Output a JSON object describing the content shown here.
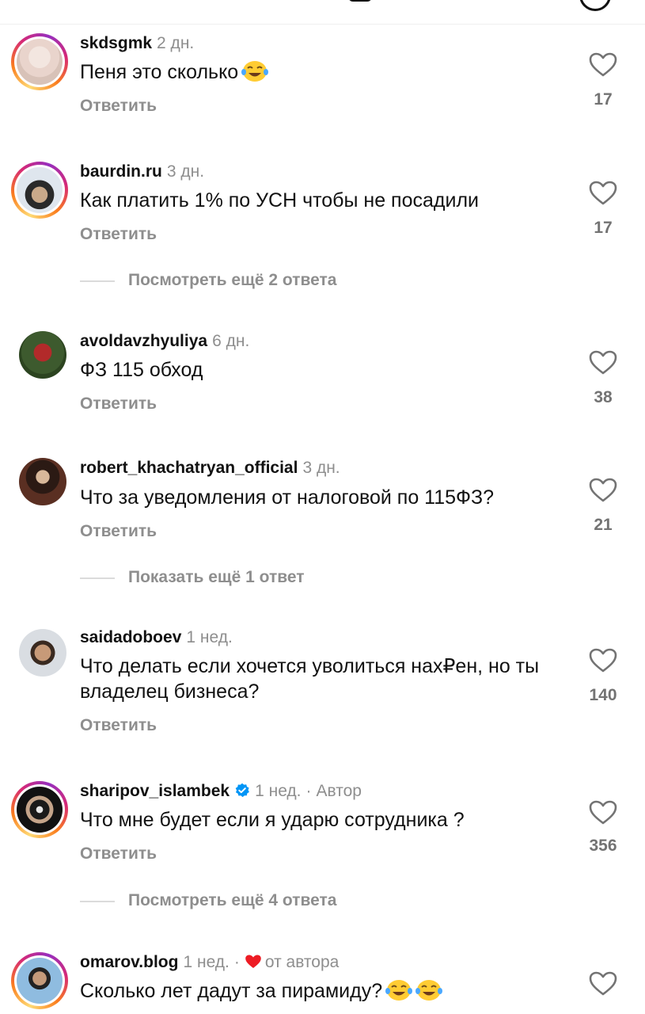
{
  "header": {},
  "comments": [
    {
      "username": "skdsgmk",
      "time": "2 дн.",
      "text": "Пеня это сколько",
      "emoji": "😂",
      "reply_label": "Ответить",
      "likes": "17",
      "has_story_ring": true
    },
    {
      "username": "baurdin.ru",
      "time": "3 дн.",
      "text": "Как платить 1% по УСН чтобы не посадили",
      "reply_label": "Ответить",
      "likes": "17",
      "has_story_ring": true,
      "more_replies": "Посмотреть ещё 2 ответа"
    },
    {
      "username": "avoldavzhyuliya",
      "time": "6 дн.",
      "text": "ФЗ 115 обход",
      "reply_label": "Ответить",
      "likes": "38",
      "has_story_ring": false
    },
    {
      "username": "robert_khachatryan_official",
      "time": "3 дн.",
      "text": "Что за уведомления от налоговой по 115ФЗ?",
      "reply_label": "Ответить",
      "likes": "21",
      "has_story_ring": false,
      "more_replies": "Показать ещё 1 ответ"
    },
    {
      "username": "saidadoboev",
      "time": "1 нед.",
      "text": "Что делать если хочется уволиться нах₽ен, но ты владелец бизнеса?",
      "reply_label": "Ответить",
      "likes": "140",
      "has_story_ring": false
    },
    {
      "username": "sharipov_islambek",
      "time": "1 нед.",
      "author_label": "Автор",
      "verified": true,
      "text": "Что мне будет если я ударю сотрудника ?",
      "reply_label": "Ответить",
      "likes": "356",
      "has_story_ring": true,
      "more_replies": "Посмотреть ещё 4 ответа"
    },
    {
      "username": "omarov.blog",
      "time": "1 нед.",
      "liked_by_author_label": "от автора",
      "text": "Сколько лет дадут за пирамиду?",
      "emoji": "😂😂",
      "likes": "",
      "has_story_ring": true
    }
  ],
  "colors": {
    "text_primary": "#111111",
    "text_secondary": "#8e8e8e",
    "verified_blue": "#0095f6",
    "heart_red": "#ed1c24"
  },
  "icons": {
    "like": "heart-outline-icon",
    "verified": "verified-badge-icon",
    "author_like": "heart-filled-icon",
    "emoji": "tears-of-joy-emoji"
  }
}
